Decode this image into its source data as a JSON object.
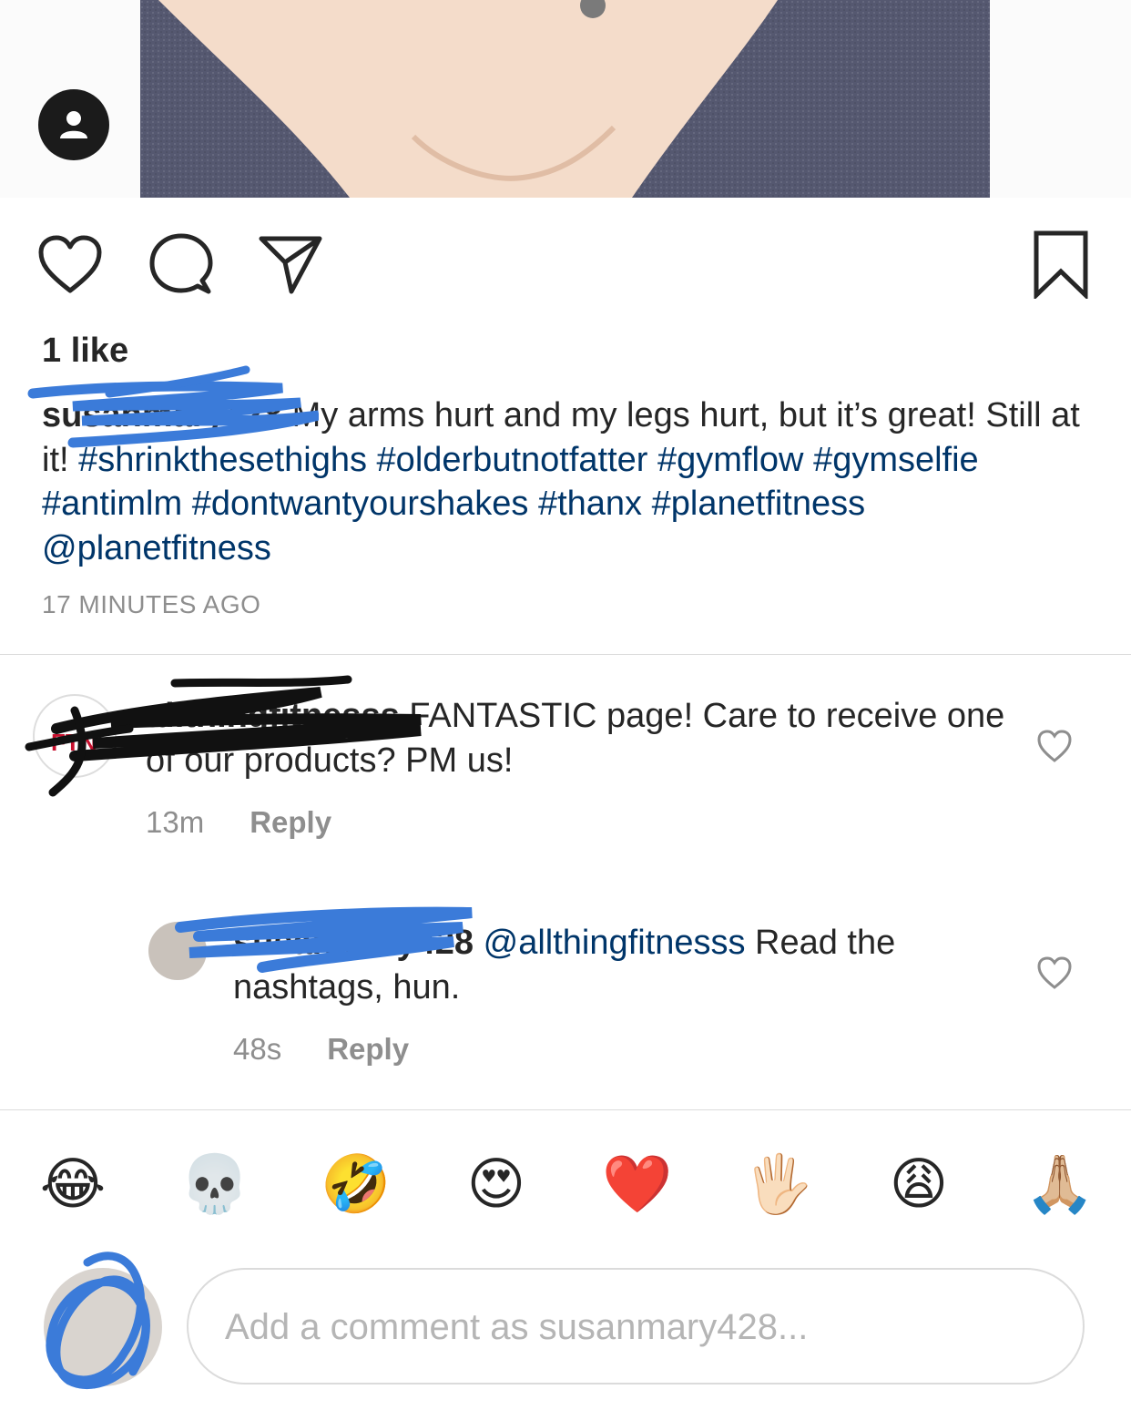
{
  "post": {
    "likes_text": "1 like",
    "caption": {
      "username": "susanmary428",
      "text": " My arms hurt and my legs hurt, but it’s great!  Still at it! ",
      "hashtags": [
        "#shrinkthesethighs",
        "#olderbutnotfatter",
        "#gymflow",
        "#gymselfie",
        "#antimlm",
        "#dontwantyourshakes",
        "#thanx",
        "#planetfitness"
      ],
      "mention": "@planetfitness"
    },
    "timestamp": "17 MINUTES AGO"
  },
  "comments": [
    {
      "username": "allthingfitnesss",
      "text": " FANTASTIC page! Care to receive one of our products? PM us!",
      "time": "13m",
      "reply_label": "Reply"
    },
    {
      "username": "susanmary428",
      "mention": "@allthingfitnesss",
      "text": " Read the nashtags, hun.",
      "time": "48s",
      "reply_label": "Reply"
    }
  ],
  "emoji_bar": [
    "😂",
    "💀",
    "🤣",
    "😍",
    "❤️",
    "🖐🏻",
    "😩",
    "🙏🏼"
  ],
  "composer": {
    "placeholder": "Add a comment as susanmary428..."
  },
  "colors": {
    "link": "#003569",
    "muted": "#8e8e8e",
    "divider": "#dbdbdb",
    "redaction_blue": "#3b7bd9"
  },
  "icons": [
    "user-icon",
    "heart-icon",
    "comment-icon",
    "share-icon",
    "bookmark-icon"
  ]
}
